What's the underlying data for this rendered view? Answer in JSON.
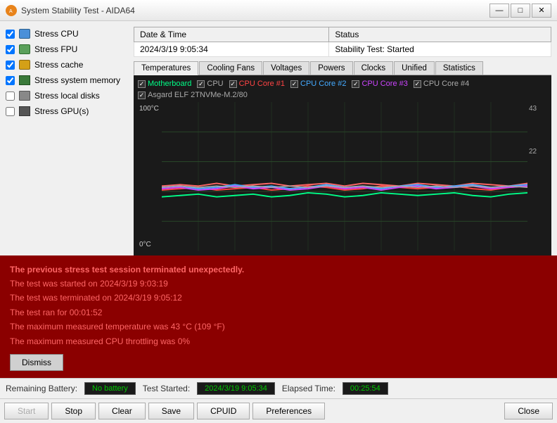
{
  "window": {
    "title": "System Stability Test - AIDA64",
    "minimize_label": "—",
    "maximize_label": "□",
    "close_label": "✕"
  },
  "checkboxes": [
    {
      "id": "stress-cpu",
      "label": "Stress CPU",
      "checked": true,
      "icon": "cpu"
    },
    {
      "id": "stress-fpu",
      "label": "Stress FPU",
      "checked": true,
      "icon": "fpu"
    },
    {
      "id": "stress-cache",
      "label": "Stress cache",
      "checked": true,
      "icon": "cache"
    },
    {
      "id": "stress-memory",
      "label": "Stress system memory",
      "checked": true,
      "icon": "mem"
    },
    {
      "id": "stress-disks",
      "label": "Stress local disks",
      "checked": false,
      "icon": "disk"
    },
    {
      "id": "stress-gpu",
      "label": "Stress GPU(s)",
      "checked": false,
      "icon": "gpu"
    }
  ],
  "status_table": {
    "headers": [
      "Date & Time",
      "Status"
    ],
    "rows": [
      {
        "datetime": "2024/3/19 9:05:34",
        "status": "Stability Test: Started"
      }
    ]
  },
  "tabs": [
    {
      "id": "temperatures",
      "label": "Temperatures",
      "active": true
    },
    {
      "id": "cooling-fans",
      "label": "Cooling Fans",
      "active": false
    },
    {
      "id": "voltages",
      "label": "Voltages",
      "active": false
    },
    {
      "id": "powers",
      "label": "Powers",
      "active": false
    },
    {
      "id": "clocks",
      "label": "Clocks",
      "active": false
    },
    {
      "id": "unified",
      "label": "Unified",
      "active": false
    },
    {
      "id": "statistics",
      "label": "Statistics",
      "active": false
    }
  ],
  "chart": {
    "legend": [
      {
        "label": "Motherboard",
        "checked": true,
        "color": "#00ff88"
      },
      {
        "label": "CPU",
        "checked": true,
        "color": "#bbbbbb"
      },
      {
        "label": "CPU Core #1",
        "checked": true,
        "color": "#ff4444"
      },
      {
        "label": "CPU Core #2",
        "checked": true,
        "color": "#44aaff"
      },
      {
        "label": "CPU Core #3",
        "checked": true,
        "color": "#cc44ff"
      },
      {
        "label": "CPU Core #4",
        "checked": true,
        "color": "#aaaaaa"
      },
      {
        "label": "Asgard ELF 2TNVMe-M.2/80",
        "checked": true,
        "color": "#bbbbbb"
      }
    ],
    "y_max": "100°C",
    "y_min": "0°C",
    "r_max": "43",
    "r_min": "22"
  },
  "error_panel": {
    "lines": [
      "The previous stress test session terminated unexpectedly.",
      "The test was started on 2024/3/19 9:03:19",
      "The test was terminated on 2024/3/19 9:05:12",
      "The test ran for 00:01:52",
      "The maximum measured temperature was 43 °C  (109 °F)",
      "The maximum measured CPU throttling was 0%"
    ],
    "dismiss_label": "Dismiss"
  },
  "status_bar": {
    "battery_label": "Remaining Battery:",
    "battery_value": "No battery",
    "test_started_label": "Test Started:",
    "test_started_value": "2024/3/19 9:05:34",
    "elapsed_label": "Elapsed Time:",
    "elapsed_value": "00:25:54"
  },
  "toolbar": {
    "start_label": "Start",
    "stop_label": "Stop",
    "clear_label": "Clear",
    "save_label": "Save",
    "cpuid_label": "CPUID",
    "preferences_label": "Preferences",
    "close_label": "Close"
  }
}
